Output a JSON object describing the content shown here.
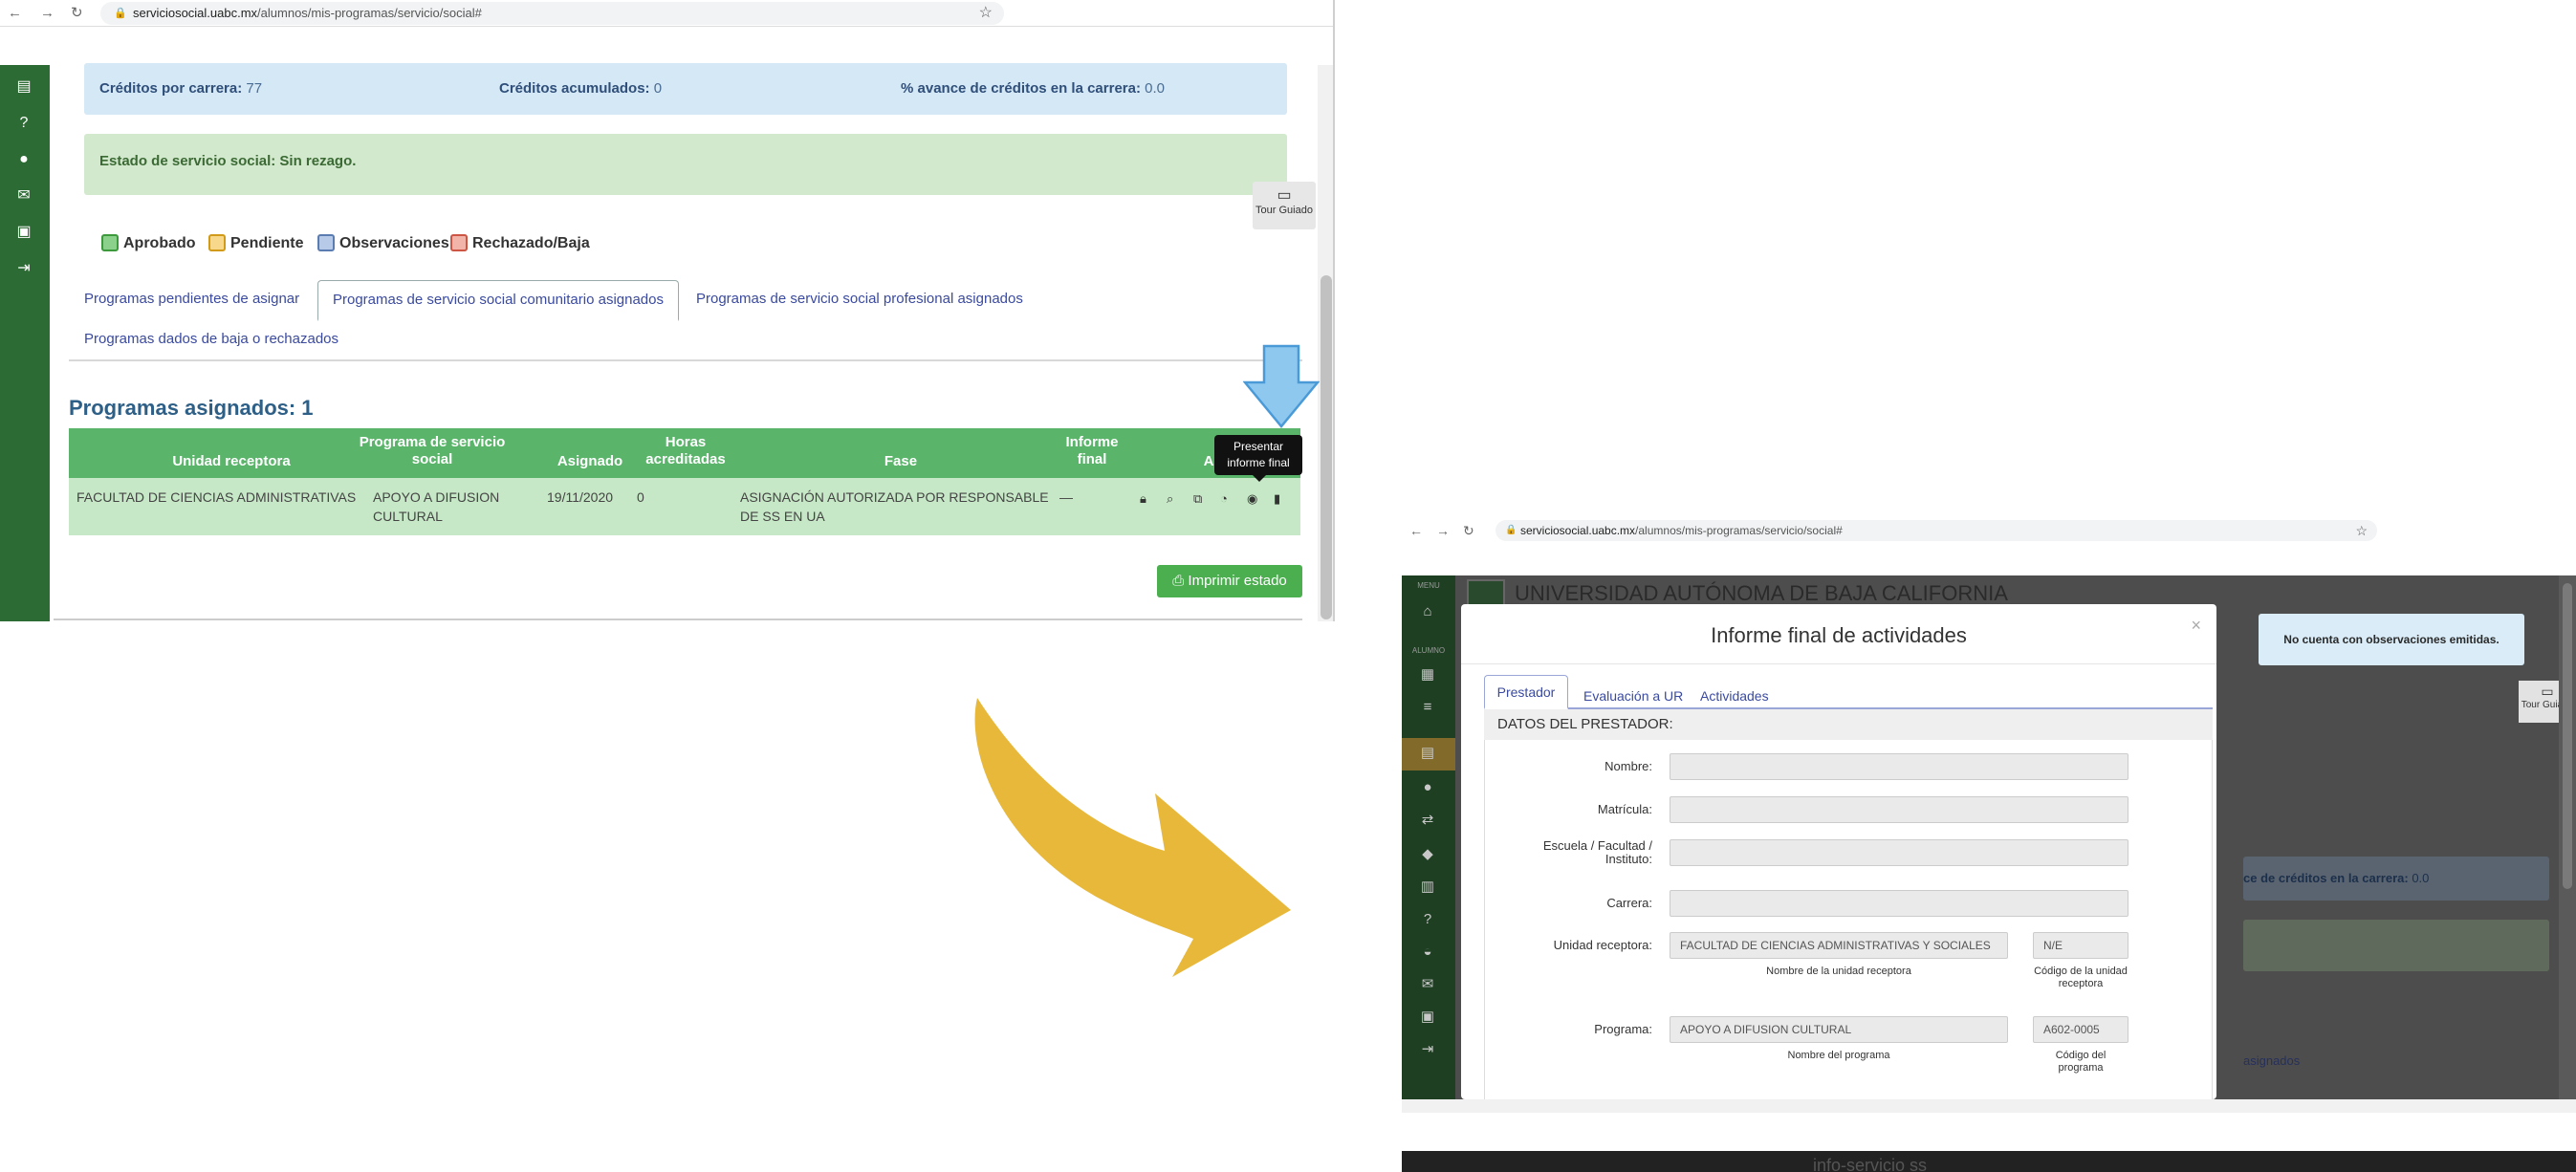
{
  "left": {
    "url_domain": "serviciosocial.uabc.mx",
    "url_path": "/alumnos/mis-programas/servicio/social#",
    "sidebar_icons": [
      "document-icon",
      "help-icon",
      "chat-icon",
      "mail-icon",
      "contact-icon",
      "logout-icon"
    ],
    "credits": {
      "per_career_label": "Créditos por carrera:",
      "per_career_value": "77",
      "accumulated_label": "Créditos acumulados:",
      "accumulated_value": "0",
      "progress_label": "% avance de créditos en la carrera:",
      "progress_value": "0.0"
    },
    "status_text": "Estado de servicio social: Sin rezago.",
    "tour_label": "Tour Guiado",
    "legend": [
      {
        "label": "Aprobado",
        "color": "#8bd08b",
        "border": "#3c9a3c"
      },
      {
        "label": "Pendiente",
        "color": "#f8d88a",
        "border": "#d19a19"
      },
      {
        "label": "Observaciones",
        "color": "#b7cbe8",
        "border": "#5a7cb0"
      },
      {
        "label": "Rechazado/Baja",
        "color": "#f2b3a8",
        "border": "#cc5544"
      }
    ],
    "tabs": {
      "pending": "Programas pendientes de asignar",
      "community": "Programas de servicio social comunitario asignados",
      "professional": "Programas de servicio social profesional asignados",
      "dropped": "Programas dados de baja o rechazados"
    },
    "assigned_title": "Programas asignados: 1",
    "table": {
      "headers": {
        "unit": "Unidad receptora",
        "program_1": "Programa de servicio",
        "program_2": "social",
        "assigned": "Asignado",
        "hours_1": "Horas",
        "hours_2": "acreditadas",
        "phase": "Fase",
        "report_1": "Informe",
        "report_2": "final",
        "actions": "Acciones"
      },
      "row": {
        "unit": "FACULTAD DE CIENCIAS ADMINISTRATIVAS",
        "program_1": "APOYO A DIFUSION",
        "program_2": "CULTURAL",
        "assigned": "19/11/2020",
        "hours": "0",
        "phase_1": "ASIGNACIÓN AUTORIZADA POR RESPONSABLE",
        "phase_2": "DE SS EN UA",
        "report": "—"
      }
    },
    "tooltip_1": "Presentar",
    "tooltip_2": "informe final",
    "print_label": "Imprimir estado"
  },
  "arrows": {
    "blue": "#8ec8ee",
    "blue_border": "#4a9ad8",
    "yellow": "#e8b83a"
  },
  "right": {
    "url_domain": "serviciosocial.uabc.mx",
    "url_path": "/alumnos/mis-programas/servicio/social#",
    "bg_title": "UNIVERSIDAD AUTÓNOMA DE BAJA CALIFORNIA",
    "side_tags": {
      "menu": "MENU",
      "student": "ALUMNO"
    },
    "alert": "No cuenta con observaciones emitidas.",
    "tour_label": "Tour Guiado",
    "bg_progress_label": "ce de créditos en la carrera:",
    "bg_progress_value": "0.0",
    "bg_tab_fragment": "asignados",
    "footer_text": "info-servicio ss",
    "modal": {
      "title": "Informe final de actividades",
      "close": "×",
      "tabs": {
        "provider": "Prestador",
        "evaluation": "Evaluación a UR",
        "activities": "Actividades"
      },
      "section": "DATOS DEL PRESTADOR:",
      "labels": {
        "name": "Nombre:",
        "matricula": "Matrícula:",
        "school_1": "Escuela / Facultad /",
        "school_2": "Instituto:",
        "career": "Carrera:",
        "unit": "Unidad receptora:",
        "program": "Programa:"
      },
      "values": {
        "unit": "FACULTAD DE CIENCIAS ADMINISTRATIVAS Y SOCIALES",
        "unit_code": "N/E",
        "program": "APOYO A DIFUSION CULTURAL",
        "program_code": "A602-0005"
      },
      "help": {
        "unit_name": "Nombre de la unidad receptora",
        "unit_code_1": "Código de la unidad",
        "unit_code_2": "receptora",
        "program_name": "Nombre del programa",
        "program_code_1": "Código del",
        "program_code_2": "programa"
      }
    }
  }
}
